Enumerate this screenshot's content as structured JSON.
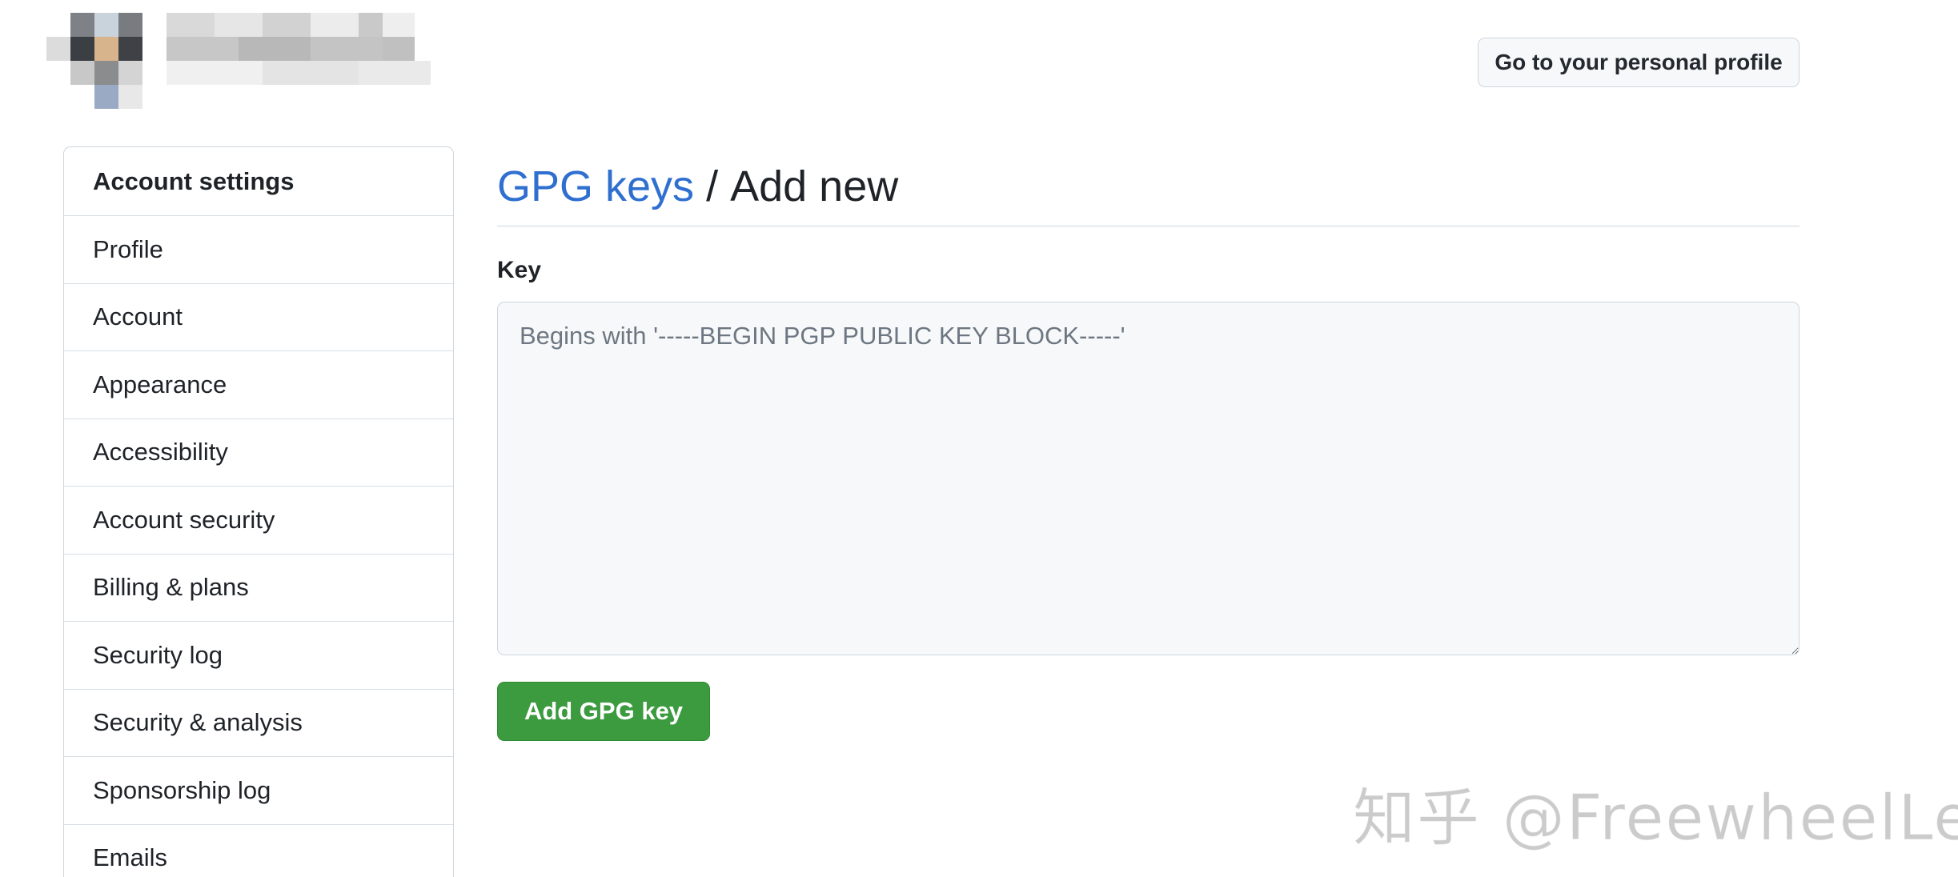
{
  "header": {
    "profile_button_label": "Go to your personal profile"
  },
  "sidebar": {
    "header": "Account settings",
    "items": [
      {
        "label": "Profile"
      },
      {
        "label": "Account"
      },
      {
        "label": "Appearance"
      },
      {
        "label": "Accessibility"
      },
      {
        "label": "Account security"
      },
      {
        "label": "Billing & plans"
      },
      {
        "label": "Security log"
      },
      {
        "label": "Security & analysis"
      },
      {
        "label": "Sponsorship log"
      },
      {
        "label": "Emails"
      }
    ]
  },
  "main": {
    "breadcrumb_link": "GPG keys",
    "breadcrumb_separator": " / ",
    "breadcrumb_current": "Add new",
    "key_label": "Key",
    "key_placeholder": "Begins with '-----BEGIN PGP PUBLIC KEY BLOCK-----'",
    "key_value": "",
    "submit_label": "Add GPG key"
  },
  "watermark": "知乎 @FreewheelLee",
  "colors": {
    "link": "#2f6fd0",
    "primary_button": "#3c9a3f",
    "border": "#d0d7de",
    "input_bg": "#f6f8fa"
  }
}
